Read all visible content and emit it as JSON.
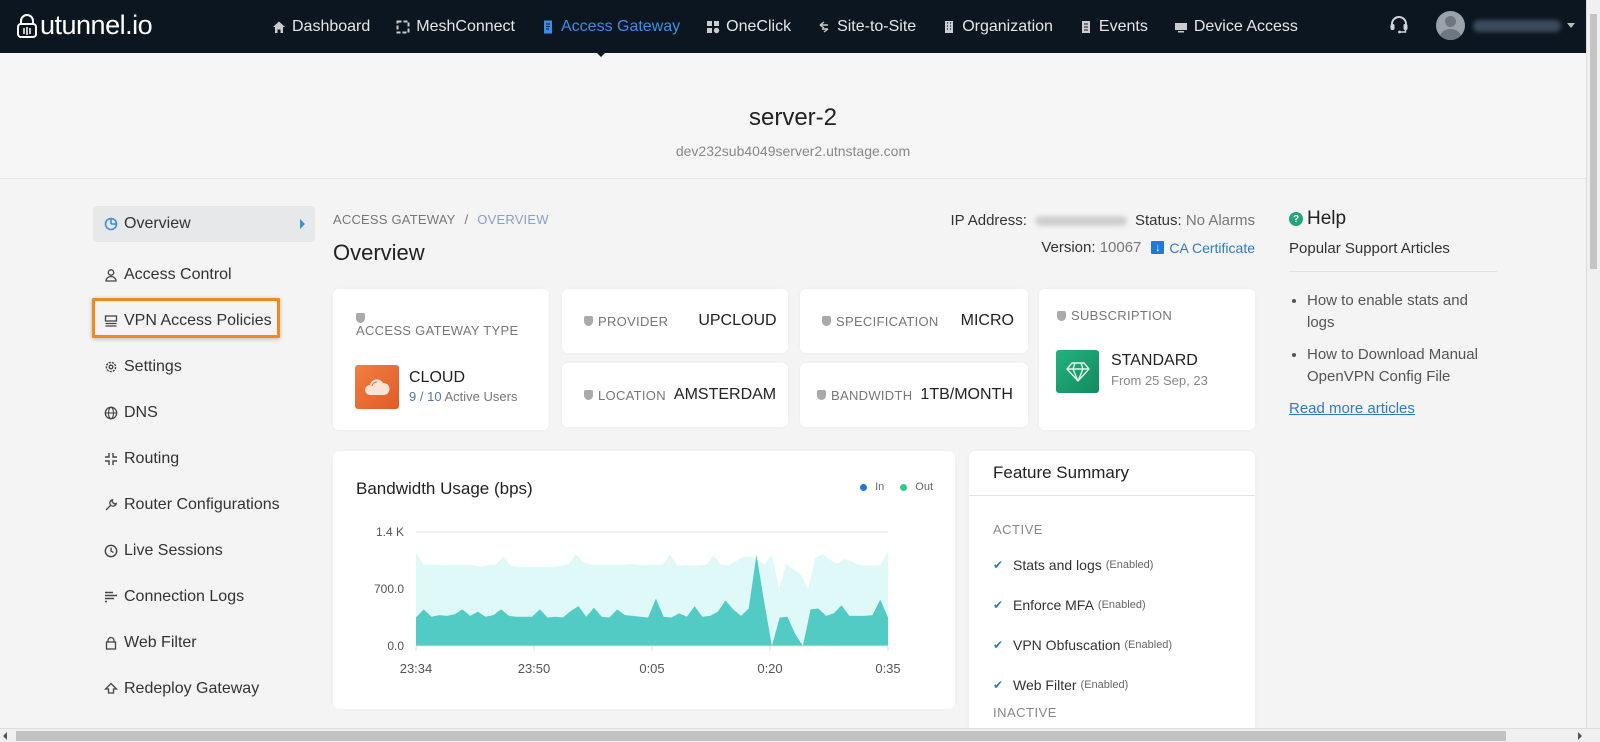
{
  "app": {
    "brand": "utunnel.io"
  },
  "nav": {
    "items": [
      {
        "label": "Dashboard",
        "icon": "home-icon"
      },
      {
        "label": "MeshConnect",
        "icon": "mesh-icon"
      },
      {
        "label": "Access Gateway",
        "icon": "gateway-icon",
        "active": true
      },
      {
        "label": "OneClick",
        "icon": "grid-icon"
      },
      {
        "label": "Site-to-Site",
        "icon": "arrows-icon"
      },
      {
        "label": "Organization",
        "icon": "building-icon"
      },
      {
        "label": "Events",
        "icon": "list-icon"
      },
      {
        "label": "Device Access",
        "icon": "monitor-icon"
      }
    ],
    "support_icon": "headset-icon",
    "user_name": "(blurred)"
  },
  "server": {
    "name": "server-2",
    "host": "dev232sub4049server2.utnstage.com"
  },
  "sidebar": {
    "items": [
      {
        "label": "Overview",
        "icon": "pie-chart-icon",
        "active": true
      },
      {
        "label": "Access Control",
        "icon": "user-icon"
      },
      {
        "label": "VPN Access Policies",
        "icon": "policy-icon",
        "highlighted": true
      },
      {
        "label": "Settings",
        "icon": "gear-icon"
      },
      {
        "label": "DNS",
        "icon": "globe-icon"
      },
      {
        "label": "Routing",
        "icon": "routing-icon"
      },
      {
        "label": "Router Configurations",
        "icon": "wrench-icon"
      },
      {
        "label": "Live Sessions",
        "icon": "clock-icon"
      },
      {
        "label": "Connection Logs",
        "icon": "lines-icon"
      },
      {
        "label": "Web Filter",
        "icon": "lock-icon"
      },
      {
        "label": "Redeploy Gateway",
        "icon": "redeploy-icon"
      }
    ]
  },
  "breadcrumb": {
    "root": "ACCESS GATEWAY",
    "separator": "/",
    "current": "OVERVIEW"
  },
  "page": {
    "title": "Overview"
  },
  "meta": {
    "ip_label": "IP Address:",
    "status_label": "Status:",
    "status_value": "No Alarms",
    "version_label": "Version:",
    "version_value": "10067",
    "ca_link": "CA Certificate"
  },
  "cards": {
    "type": {
      "label": "ACCESS GATEWAY TYPE",
      "value": "CLOUD",
      "active_users": "9",
      "total_users": "10",
      "users_suffix": "Active Users",
      "users_sep": "/"
    },
    "provider": {
      "label": "PROVIDER",
      "value": "UPCLOUD"
    },
    "location": {
      "label": "LOCATION",
      "value": "AMSTERDAM"
    },
    "specification": {
      "label": "SPECIFICATION",
      "value": "MICRO"
    },
    "bandwidth": {
      "label": "BANDWIDTH",
      "value": "1TB/MONTH"
    },
    "subscription": {
      "label": "SUBSCRIPTION",
      "value": "STANDARD",
      "from": "From 25 Sep, 23"
    }
  },
  "chart_data": {
    "type": "area",
    "title": "Bandwidth Usage (bps)",
    "xlabel": "",
    "ylabel": "",
    "ylim": [
      0,
      1400
    ],
    "y_ticks": [
      "0.0",
      "700.0",
      "1.4 K"
    ],
    "y_tick_values": [
      0,
      700,
      1400
    ],
    "x_ticks": [
      "23:34",
      "23:50",
      "0:05",
      "0:20",
      "0:35"
    ],
    "legend": [
      "In",
      "Out"
    ],
    "legend_position": "top-right",
    "grid": true,
    "colors": {
      "In": "#1e7ad6",
      "Out": "#2ecc8f",
      "area_out": "#dff8f8",
      "area_in": "#52cbc4"
    },
    "series": [
      {
        "name": "Out",
        "values": [
          1150,
          1000,
          1000,
          1000,
          990,
          1000,
          1000,
          1000,
          990,
          970,
          1000,
          1000,
          1100,
          990,
          970,
          970,
          970,
          970,
          970,
          970,
          990,
          1000,
          1130,
          1030,
          1000,
          1000,
          1000,
          1000,
          1000,
          1000,
          1010,
          990,
          1000,
          1000,
          1000,
          1120,
          990,
          990,
          990,
          990,
          1000,
          1110,
          1000,
          990,
          1040,
          1090,
          1100,
          1060,
          1000,
          1120,
          700,
          1010,
          940,
          880,
          700,
          1080,
          1130,
          1060,
          1010,
          1070,
          1040,
          990,
          990,
          990,
          1000,
          1160
        ]
      },
      {
        "name": "In",
        "values": [
          350,
          450,
          360,
          380,
          370,
          390,
          450,
          370,
          420,
          360,
          380,
          450,
          370,
          360,
          360,
          360,
          450,
          350,
          360,
          350,
          430,
          490,
          360,
          470,
          360,
          350,
          450,
          380,
          370,
          360,
          350,
          580,
          360,
          350,
          400,
          360,
          490,
          360,
          370,
          420,
          560,
          450,
          370,
          460,
          1120,
          540,
          0,
          350,
          360,
          150,
          0,
          450,
          460,
          370,
          400,
          500,
          370,
          370,
          370,
          380,
          570,
          350
        ]
      }
    ]
  },
  "features": {
    "title": "Feature Summary",
    "active_label": "ACTIVE",
    "inactive_label": "INACTIVE",
    "active": [
      {
        "name": "Stats and logs",
        "status": "(Enabled)"
      },
      {
        "name": "Enforce MFA",
        "status": "(Enabled)"
      },
      {
        "name": "VPN Obfuscation",
        "status": "(Enabled)"
      },
      {
        "name": "Web Filter",
        "status": "(Enabled)"
      }
    ]
  },
  "help": {
    "title": "Help",
    "subtitle": "Popular Support Articles",
    "articles": [
      "How to enable stats and logs",
      "How to Download Manual OpenVPN Config File"
    ],
    "more_link": "Read more articles"
  }
}
